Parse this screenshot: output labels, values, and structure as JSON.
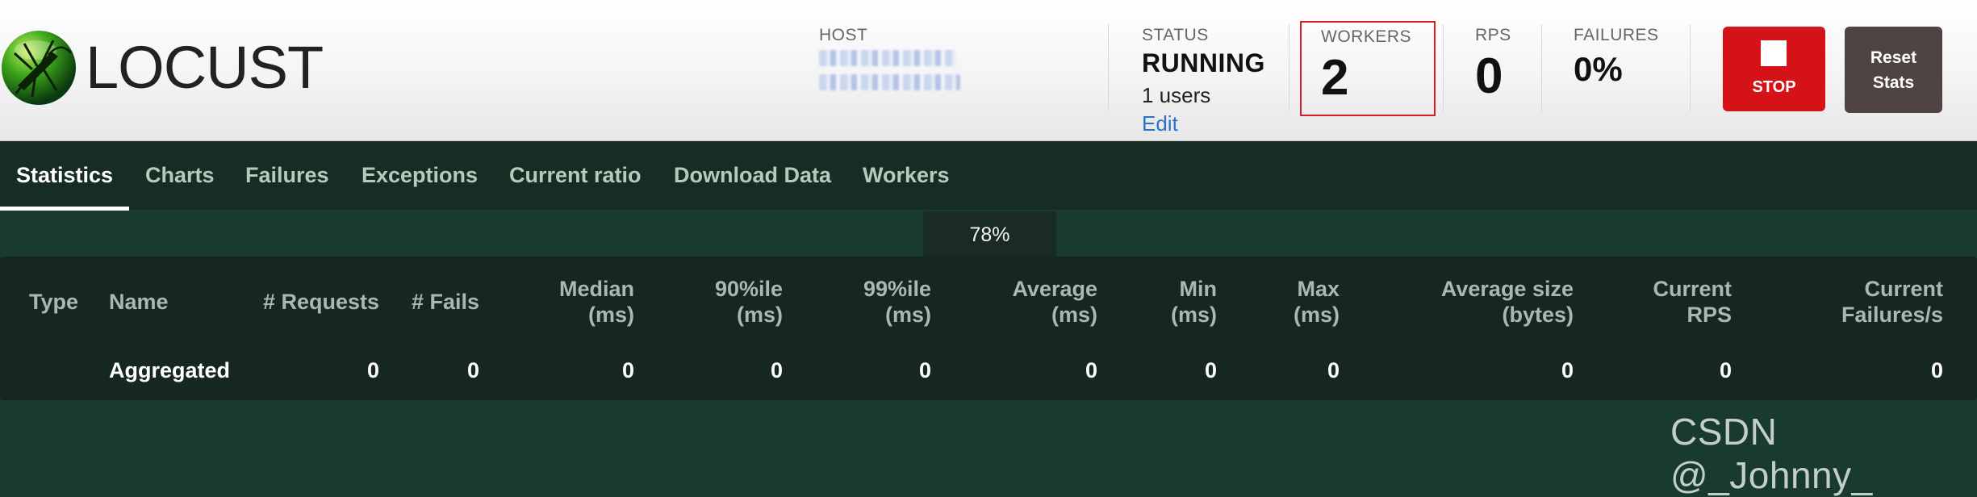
{
  "app": {
    "name": "LOCUST"
  },
  "header": {
    "host": {
      "label": "HOST"
    },
    "status": {
      "label": "STATUS",
      "value": "RUNNING",
      "users": "1 users",
      "edit": "Edit"
    },
    "workers": {
      "label": "WORKERS",
      "value": "2"
    },
    "rps": {
      "label": "RPS",
      "value": "0"
    },
    "failures": {
      "label": "FAILURES",
      "value": "0%"
    },
    "stop_label": "STOP",
    "reset_label": "Reset Stats"
  },
  "nav": {
    "tabs": [
      {
        "label": "Statistics",
        "active": true
      },
      {
        "label": "Charts"
      },
      {
        "label": "Failures"
      },
      {
        "label": "Exceptions"
      },
      {
        "label": "Current ratio"
      },
      {
        "label": "Download Data"
      },
      {
        "label": "Workers"
      }
    ]
  },
  "progress": {
    "label": "78%",
    "value": 0.78
  },
  "stats": {
    "columns": [
      "Type",
      "Name",
      "# Requests",
      "# Fails",
      "Median (ms)",
      "90%ile (ms)",
      "99%ile (ms)",
      "Average (ms)",
      "Min (ms)",
      "Max (ms)",
      "Average size (bytes)",
      "Current RPS",
      "Current Failures/s"
    ],
    "column_lines": [
      [
        "Type"
      ],
      [
        "Name"
      ],
      [
        "# Requests"
      ],
      [
        "# Fails"
      ],
      [
        "Median",
        "(ms)"
      ],
      [
        "90%ile",
        "(ms)"
      ],
      [
        "99%ile",
        "(ms)"
      ],
      [
        "Average",
        "(ms)"
      ],
      [
        "Min",
        "(ms)"
      ],
      [
        "Max",
        "(ms)"
      ],
      [
        "Average size",
        "(bytes)"
      ],
      [
        "Current",
        "RPS"
      ],
      [
        "Current",
        "Failures/s"
      ]
    ],
    "rows": [
      {
        "type": "",
        "name": "Aggregated",
        "requests": "0",
        "fails": "0",
        "median": "0",
        "p90": "0",
        "p99": "0",
        "average": "0",
        "min": "0",
        "max": "0",
        "avg_size": "0",
        "current_rps": "0",
        "current_failures": "0"
      }
    ]
  },
  "watermark": "CSDN @_Johnny_",
  "colors": {
    "stop": "#d61219",
    "reset": "#4f4442",
    "header_bg": "#f4f4f4",
    "nav_bg": "#172d23",
    "page_bg": "#193a2f",
    "workers_outline": "#d51e2a",
    "link": "#2a72c8"
  }
}
